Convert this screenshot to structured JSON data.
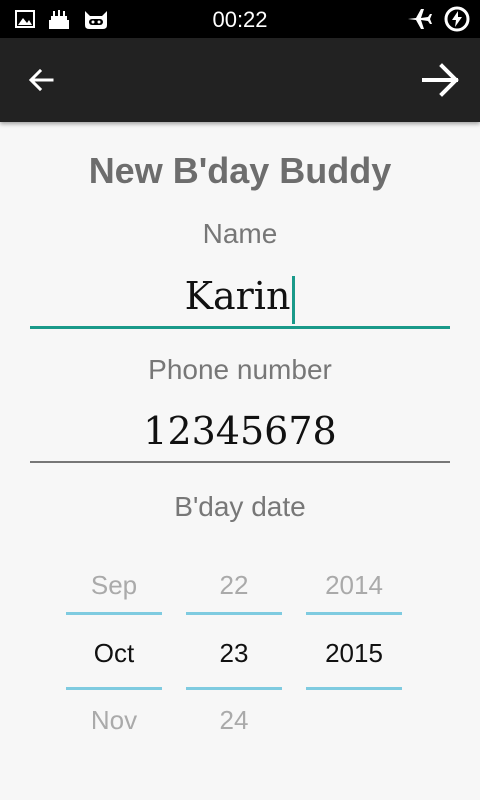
{
  "status_bar": {
    "time": "00:22",
    "left_icons": [
      "image-icon",
      "cake-icon",
      "cyanogen-icon"
    ],
    "right_icons": [
      "airplane-mode-icon",
      "battery-charging-icon"
    ]
  },
  "toolbar": {
    "back_icon": "arrow-left-icon",
    "next_icon": "arrow-right-icon"
  },
  "form": {
    "title": "New B'day Buddy",
    "name_label": "Name",
    "name_value": "Karin",
    "phone_label": "Phone number",
    "phone_value": "12345678",
    "date_label": "B'day date"
  },
  "date_picker": {
    "month": {
      "prev": "Sep",
      "selected": "Oct",
      "next": "Nov"
    },
    "day": {
      "prev": "22",
      "selected": "23",
      "next": "24"
    },
    "year": {
      "prev": "2014",
      "selected": "2015",
      "next": ""
    }
  },
  "colors": {
    "accent": "#1a9a8a",
    "picker_line": "#7fcbe0",
    "toolbar": "#222222",
    "background": "#f7f7f7"
  }
}
